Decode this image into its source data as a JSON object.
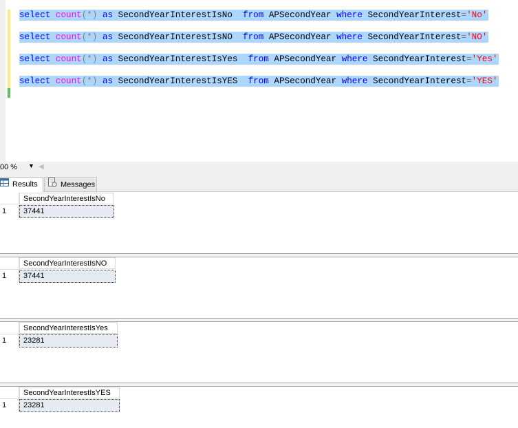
{
  "editor": {
    "lines": [
      {
        "select_kw": "select",
        "count_fn": "count",
        "paren": "(*)",
        "as_kw": "as",
        "alias": "SecondYearInterestIsNo",
        "from_kw": "from",
        "table": "APSecondYear",
        "where_kw": "where",
        "column": "SecondYearInterest",
        "eq": "=",
        "literal": "'No'"
      },
      {
        "select_kw": "select",
        "count_fn": "count",
        "paren": "(*)",
        "as_kw": "as",
        "alias": "SecondYearInterestIsNO",
        "from_kw": "from",
        "table": "APSecondYear",
        "where_kw": "where",
        "column": "SecondYearInterest",
        "eq": "=",
        "literal": "'NO'"
      },
      {
        "select_kw": "select",
        "count_fn": "count",
        "paren": "(*)",
        "as_kw": "as",
        "alias": "SecondYearInterestIsYes",
        "from_kw": "from",
        "table": "APSecondYear",
        "where_kw": "where",
        "column": "SecondYearInterest",
        "eq": "=",
        "literal": "'Yes'"
      },
      {
        "select_kw": "select",
        "count_fn": "count",
        "paren": "(*)",
        "as_kw": "as",
        "alias": "SecondYearInterestIsYES",
        "from_kw": "from",
        "table": "APSecondYear",
        "where_kw": "where",
        "column": "SecondYearInterest",
        "eq": "=",
        "literal": "'YES'"
      }
    ]
  },
  "zoom": {
    "value": "00 %"
  },
  "tabs": {
    "results": "Results",
    "messages": "Messages"
  },
  "result_grids": [
    {
      "header": "SecondYearInterestIsNo",
      "row_number": "1",
      "value": "37441"
    },
    {
      "header": "SecondYearInterestIsNO",
      "row_number": "1",
      "value": "37441"
    },
    {
      "header": "SecondYearInterestIsYes",
      "row_number": "1",
      "value": "23281"
    },
    {
      "header": "SecondYearInterestIsYES",
      "row_number": "1",
      "value": "23281"
    }
  ],
  "colors": {
    "keyword": "#0000ff",
    "function": "#ff00ff",
    "string": "#ff0000",
    "selection": "#add6ff",
    "selected_cell": "#e5ebf1"
  }
}
